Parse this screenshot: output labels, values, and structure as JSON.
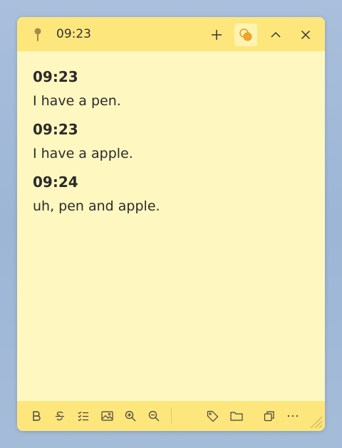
{
  "titlebar": {
    "time": "09:23",
    "icons": [
      "pin-icon",
      "add-icon",
      "color-theme-icon",
      "collapse-icon",
      "close-icon"
    ]
  },
  "entries": [
    {
      "time": "09:23",
      "text": "I have a pen."
    },
    {
      "time": "09:23",
      "text": "I have a apple."
    },
    {
      "time": "09:24",
      "text": "uh, pen and apple."
    }
  ],
  "footer": {
    "icons": [
      "bold-icon",
      "strikethrough-icon",
      "checklist-icon",
      "image-icon",
      "zoom-in-icon",
      "zoom-out-icon",
      "tag-icon",
      "folder-icon",
      "window-icon",
      "more-icon"
    ]
  },
  "colors": {
    "note_background": "#fef7c0",
    "bar_background": "#fde67c",
    "active_button": "#fef3b0",
    "theme_accent": "#f0a526",
    "desktop": "#a9bfdc"
  }
}
